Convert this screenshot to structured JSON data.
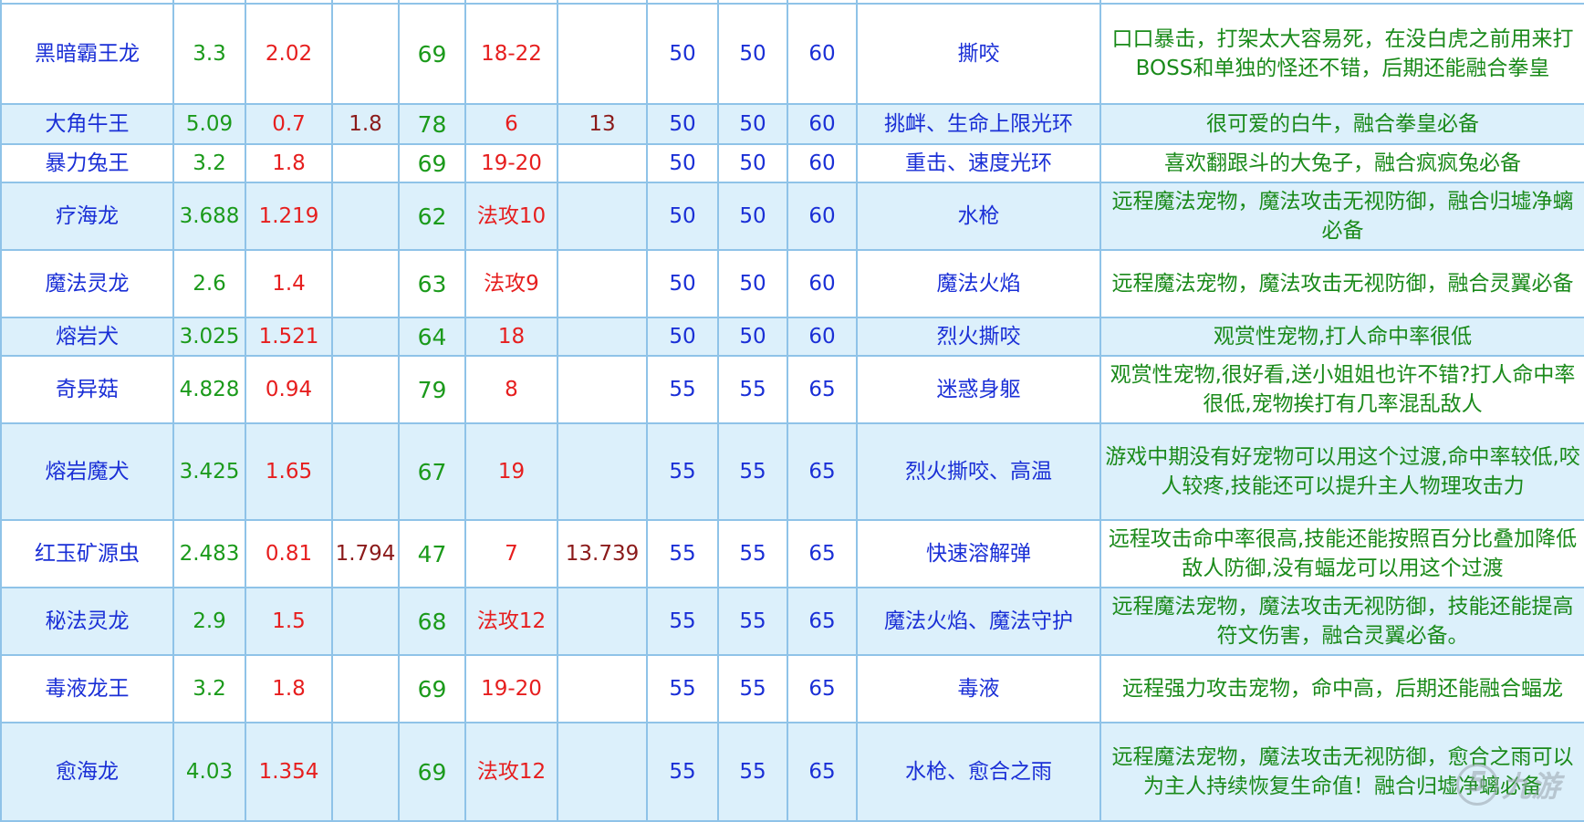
{
  "columns": [
    "name",
    "c1",
    "c2",
    "c3",
    "c4",
    "c5",
    "c6",
    "c7",
    "c8",
    "c9",
    "skill",
    "note"
  ],
  "rows": [
    {
      "name": "黑暗霸王龙",
      "c1": "3.3",
      "c2": "2.02",
      "c3": "",
      "c4": "69",
      "c5": "18-22",
      "c6": "",
      "c7": "50",
      "c8": "50",
      "c9": "60",
      "skill": "撕咬",
      "note": "口口暴击，打架太大容易死，在没白虎之前用来打BOSS和单独的怪还不错，后期还能融合拳皇"
    },
    {
      "name": "大角牛王",
      "c1": "5.09",
      "c2": "0.7",
      "c3": "1.8",
      "c4": "78",
      "c5": "6",
      "c6": "13",
      "c7": "50",
      "c8": "50",
      "c9": "60",
      "skill": "挑衅、生命上限光环",
      "note": "很可爱的白牛，融合拳皇必备"
    },
    {
      "name": "暴力兔王",
      "c1": "3.2",
      "c2": "1.8",
      "c3": "",
      "c4": "69",
      "c5": "19-20",
      "c6": "",
      "c7": "50",
      "c8": "50",
      "c9": "60",
      "skill": "重击、速度光环",
      "note": "喜欢翻跟斗的大兔子，融合疯疯兔必备"
    },
    {
      "name": "疗海龙",
      "c1": "3.688",
      "c2": "1.219",
      "c3": "",
      "c4": "62",
      "c5": "法攻10",
      "c6": "",
      "c7": "50",
      "c8": "50",
      "c9": "60",
      "skill": "水枪",
      "note": "远程魔法宠物，魔法攻击无视防御，融合归墟净螭必备"
    },
    {
      "name": "魔法灵龙",
      "c1": "2.6",
      "c2": "1.4",
      "c3": "",
      "c4": "63",
      "c5": "法攻9",
      "c6": "",
      "c7": "50",
      "c8": "50",
      "c9": "60",
      "skill": "魔法火焰",
      "note": "远程魔法宠物，魔法攻击无视防御，融合灵翼必备"
    },
    {
      "name": "熔岩犬",
      "c1": "3.025",
      "c2": "1.521",
      "c3": "",
      "c4": "64",
      "c5": "18",
      "c6": "",
      "c7": "50",
      "c8": "50",
      "c9": "60",
      "skill": "烈火撕咬",
      "note": "观赏性宠物,打人命中率很低"
    },
    {
      "name": "奇异菇",
      "c1": "4.828",
      "c2": "0.94",
      "c3": "",
      "c4": "79",
      "c5": "8",
      "c6": "",
      "c7": "55",
      "c8": "55",
      "c9": "65",
      "skill": "迷惑身躯",
      "note": "观赏性宠物,很好看,送小姐姐也许不错?打人命中率很低,宠物挨打有几率混乱敌人"
    },
    {
      "name": "熔岩魔犬",
      "c1": "3.425",
      "c2": "1.65",
      "c3": "",
      "c4": "67",
      "c5": "19",
      "c6": "",
      "c7": "55",
      "c8": "55",
      "c9": "65",
      "skill": "烈火撕咬、高温",
      "note": "游戏中期没有好宠物可以用这个过渡,命中率较低,咬人较疼,技能还可以提升主人物理攻击力"
    },
    {
      "name": "红玉矿源虫",
      "c1": "2.483",
      "c2": "0.81",
      "c3": "1.794",
      "c4": "47",
      "c5": "7",
      "c6": "13.739",
      "c7": "55",
      "c8": "55",
      "c9": "65",
      "skill": "快速溶解弹",
      "note": "远程攻击命中率很高,技能还能按照百分比叠加降低敌人防御,没有蝠龙可以用这个过渡"
    },
    {
      "name": "秘法灵龙",
      "c1": "2.9",
      "c2": "1.5",
      "c3": "",
      "c4": "68",
      "c5": "法攻12",
      "c6": "",
      "c7": "55",
      "c8": "55",
      "c9": "65",
      "skill": "魔法火焰、魔法守护",
      "note": "远程魔法宠物，魔法攻击无视防御，技能还能提高符文伤害，融合灵翼必备。"
    },
    {
      "name": "毒液龙王",
      "c1": "3.2",
      "c2": "1.8",
      "c3": "",
      "c4": "69",
      "c5": "19-20",
      "c6": "",
      "c7": "55",
      "c8": "55",
      "c9": "65",
      "skill": "毒液",
      "note": "远程强力攻击宠物，命中高，后期还能融合蝠龙"
    },
    {
      "name": "愈海龙",
      "c1": "4.03",
      "c2": "1.354",
      "c3": "",
      "c4": "69",
      "c5": "法攻12",
      "c6": "",
      "c7": "55",
      "c8": "55",
      "c9": "65",
      "skill": "水枪、愈合之雨",
      "note": "远程魔法宠物，魔法攻击无视防御，愈合之雨可以为主人持续恢复生命值！融合归墟净螭必备"
    }
  ],
  "watermark": {
    "text": "九游",
    "logo_icon": "nine-game-logo-icon"
  }
}
